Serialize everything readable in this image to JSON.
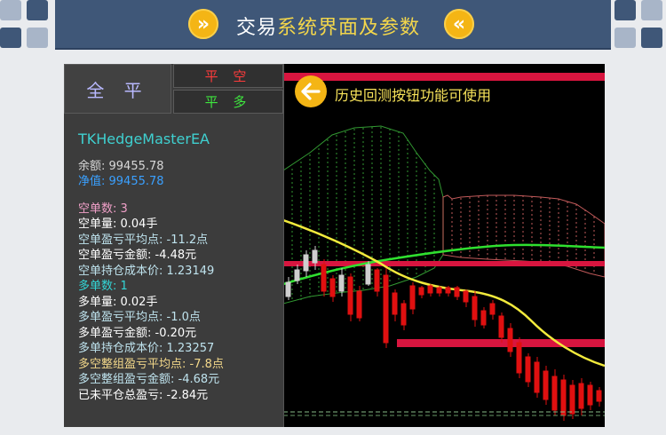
{
  "header": {
    "title_plain": "交易",
    "title_highlight": "系统界面及参数",
    "left_icon": "double-chevron-right-icon",
    "right_icon": "double-chevron-left-icon"
  },
  "buttons": {
    "close_all": "全 平",
    "close_short": "平 空",
    "close_long": "平 多"
  },
  "overlay": {
    "history_text": "历史回测按钮功能可使用",
    "history_icon": "arrow-left-icon"
  },
  "info": {
    "ea_name": "TKHedgeMasterEA",
    "balance": "余额: 99455.78",
    "equity": "净值: 99455.78",
    "short_count": "空单数: 3",
    "short_lots": "空单量: 0.04手",
    "short_avg_points": "空单盈亏平均点: -11.2点",
    "short_profit": "空单盈亏金额: -4.48元",
    "short_cost": "空单持仓成本价: 1.23149",
    "long_count": "多单数: 1",
    "long_lots": "多单量: 0.02手",
    "long_avg_points": "多单盈亏平均点: -1.0点",
    "long_profit": "多单盈亏金额: -0.20元",
    "long_cost": "多单持仓成本价: 1.23257",
    "group_avg_points": "多空整组盈亏平均点: -7.8点",
    "group_profit": "多空整组盈亏金额: -4.68元",
    "unclosed_total": "已未平仓总盈亏: -2.84元"
  },
  "colors": {
    "banner": "#3f5778",
    "accent_yellow": "#f4b515",
    "info_header": "#3fd0d0",
    "short_label": "#f0a0c8",
    "long_label": "#33d6d6",
    "equity": "#3aa0ff"
  }
}
